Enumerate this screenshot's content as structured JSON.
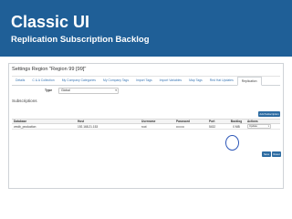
{
  "slide": {
    "title": "Classic UI",
    "subtitle": "Replication Subscription Backlog"
  },
  "screen": {
    "heading": "Settings Region \"Region 99 [99]\"",
    "tabs": [
      {
        "label": "Details",
        "active": false
      },
      {
        "label": "C & A Collection",
        "active": false
      },
      {
        "label": "My Company Categories",
        "active": false
      },
      {
        "label": "My Company Tags",
        "active": false
      },
      {
        "label": "Import Tags",
        "active": false
      },
      {
        "label": "Import Variables",
        "active": false
      },
      {
        "label": "Map Tags",
        "active": false
      },
      {
        "label": "Red Hat Updates",
        "active": false
      },
      {
        "label": "Replication",
        "active": true
      }
    ],
    "type": {
      "label": "Type",
      "value": "Global"
    },
    "section_title": "Subscriptions",
    "add_button_label": "Add Subscription",
    "table": {
      "columns": [
        "Database",
        "Host",
        "Username",
        "Password",
        "Port",
        "Backlog",
        "Actions"
      ],
      "rows": [
        {
          "database": "vmdb_production",
          "host": "192.168.21.153",
          "username": "root",
          "password": "••••••••",
          "port": "5432",
          "backlog": "0 MB",
          "action": "Update"
        }
      ]
    },
    "save_label": "Save",
    "reset_label": "Reset"
  },
  "colors": {
    "banner": "#1f5f97",
    "primary_button": "#2d6ca2",
    "highlight_circle": "#2e58b8"
  }
}
